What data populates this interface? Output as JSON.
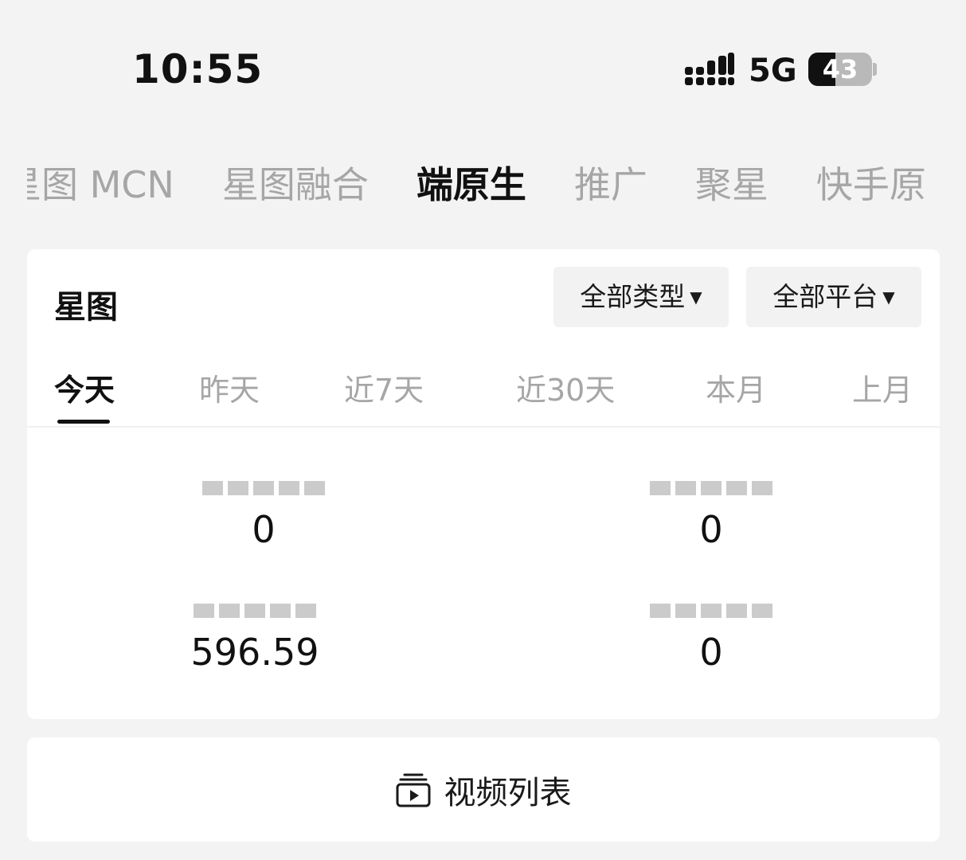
{
  "status_bar": {
    "time": "10:55",
    "network": "5G",
    "battery": "43",
    "battery_level": 43
  },
  "top_tabs": [
    {
      "label": "星图 MCN",
      "active": false
    },
    {
      "label": "星图融合",
      "active": false
    },
    {
      "label": "端原生",
      "active": true
    },
    {
      "label": "推广",
      "active": false
    },
    {
      "label": "聚星",
      "active": false
    },
    {
      "label": "快手原",
      "active": false
    }
  ],
  "card": {
    "title": "星图",
    "filter_type": "全部类型",
    "filter_platform": "全部平台",
    "date_tabs": [
      {
        "label": "今天",
        "active": true
      },
      {
        "label": "昨天",
        "active": false
      },
      {
        "label": "近7天",
        "active": false
      },
      {
        "label": "近30天",
        "active": false
      },
      {
        "label": "本月",
        "active": false
      },
      {
        "label": "上月",
        "active": false
      }
    ],
    "metrics": [
      {
        "value": "0"
      },
      {
        "value": "0"
      },
      {
        "value": "596.59"
      },
      {
        "value": "0"
      }
    ]
  },
  "video_list": {
    "label": "视频列表",
    "icon": "video-list-icon"
  },
  "colors": {
    "background": "#f3f3f3",
    "card": "#ffffff",
    "active_text": "#111111",
    "inactive_text": "#a6a6a6"
  }
}
